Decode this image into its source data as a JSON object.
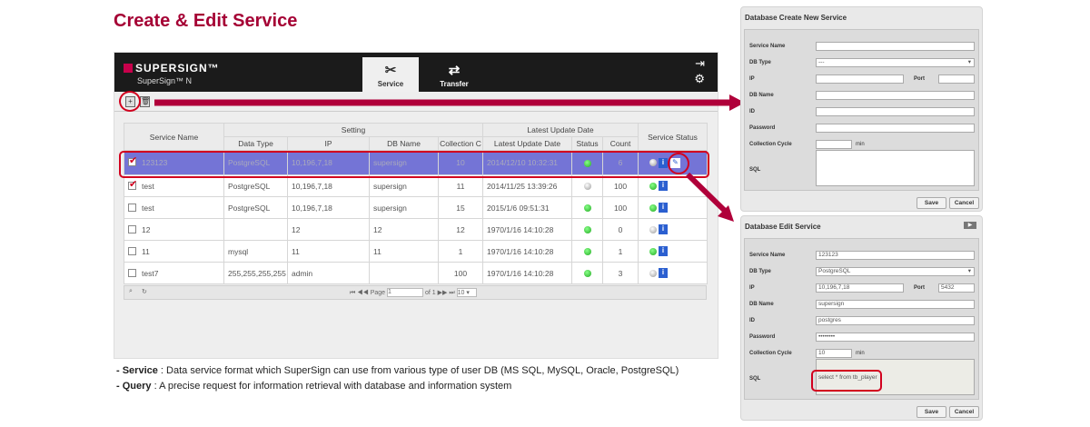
{
  "title": "Create & Edit Service",
  "app": {
    "logo": "SUPERSIGN™",
    "product": "SuperSign™ N",
    "tabs": [
      {
        "label": "Service",
        "icon": "tools-icon"
      },
      {
        "label": "Transfer",
        "icon": "transfer-icon"
      }
    ],
    "header_icons": [
      "logout-icon",
      "gear-icon"
    ]
  },
  "table": {
    "group_headers": {
      "setting": "Setting",
      "latest": "Latest Update Date"
    },
    "headers": {
      "service_name": "Service Name",
      "data_type": "Data Type",
      "ip": "IP",
      "db_name": "DB Name",
      "collection": "Collection C",
      "latest_date": "Latest Update Date",
      "status": "Status",
      "count": "Count",
      "service_status": "Service Status"
    },
    "rows": [
      {
        "checked": true,
        "selected": true,
        "name": "123123",
        "type": "PostgreSQL",
        "ip": "10,196,7,18",
        "db": "supersign",
        "coll": "10",
        "date": "2014/12/10 10:32:31",
        "status": "green",
        "count": "6",
        "svc": "grey"
      },
      {
        "checked": true,
        "name": "test",
        "type": "PostgreSQL",
        "ip": "10,196,7,18",
        "db": "supersign",
        "coll": "11",
        "date": "2014/11/25 13:39:26",
        "status": "grey",
        "count": "100",
        "svc": "green"
      },
      {
        "checked": false,
        "name": "test",
        "type": "PostgreSQL",
        "ip": "10,196,7,18",
        "db": "supersign",
        "coll": "15",
        "date": "2015/1/6 09:51:31",
        "status": "green",
        "count": "100",
        "svc": "green"
      },
      {
        "checked": false,
        "name": "12",
        "type": "",
        "ip": "12",
        "db": "12",
        "coll": "12",
        "date": "1970/1/16 14:10:28",
        "status": "green",
        "count": "0",
        "svc": "grey"
      },
      {
        "checked": false,
        "name": "11",
        "type": "mysql",
        "ip": "11",
        "db": "11",
        "coll": "1",
        "date": "1970/1/16 14:10:28",
        "status": "green",
        "count": "1",
        "svc": "green"
      },
      {
        "checked": false,
        "name": "test7",
        "type": "255,255,255,255",
        "ip": "admin",
        "db": "",
        "coll": "100",
        "date": "1970/1/16 14:10:28",
        "status": "green",
        "count": "3",
        "svc": "grey"
      }
    ],
    "pager": {
      "page_label": "Page",
      "page": "1",
      "of": "of 1",
      "page_size": "10"
    }
  },
  "descriptions": [
    {
      "term": "- Service",
      "text": " : Data service format which SuperSign can use from various type of user DB (MS SQL, MySQL, Oracle, PostgreSQL)"
    },
    {
      "term": "- Query",
      "text": " : A precise request for information  retrieval with database and information system"
    }
  ],
  "create_panel": {
    "title": "Database Create New Service",
    "labels": {
      "name": "Service Name",
      "dbtype": "DB Type",
      "ip": "IP",
      "port": "Port",
      "dbname": "DB Name",
      "id": "ID",
      "password": "Password",
      "cycle": "Collection Cycle",
      "min": "min",
      "sql": "SQL"
    },
    "values": {
      "dbtype": "---"
    },
    "save": "Save",
    "cancel": "Cancel"
  },
  "edit_panel": {
    "title": "Database Edit Service",
    "labels": {
      "name": "Service Name",
      "dbtype": "DB Type",
      "ip": "IP",
      "port": "Port",
      "dbname": "DB Name",
      "id": "ID",
      "password": "Password",
      "cycle": "Collection Cycle",
      "min": "min",
      "sql": "SQL"
    },
    "values": {
      "name": "123123",
      "dbtype": "PostgreSQL",
      "ip": "10,196,7,18",
      "port": "5432",
      "dbname": "supersign",
      "id": "postgres",
      "password": "••••••••",
      "cycle": "10",
      "sql": "select * from tb_player"
    },
    "save": "Save",
    "cancel": "Cancel"
  },
  "colors": {
    "brand": "#a50034",
    "selected_row": "#7474d6",
    "highlight": "#d2001e"
  }
}
